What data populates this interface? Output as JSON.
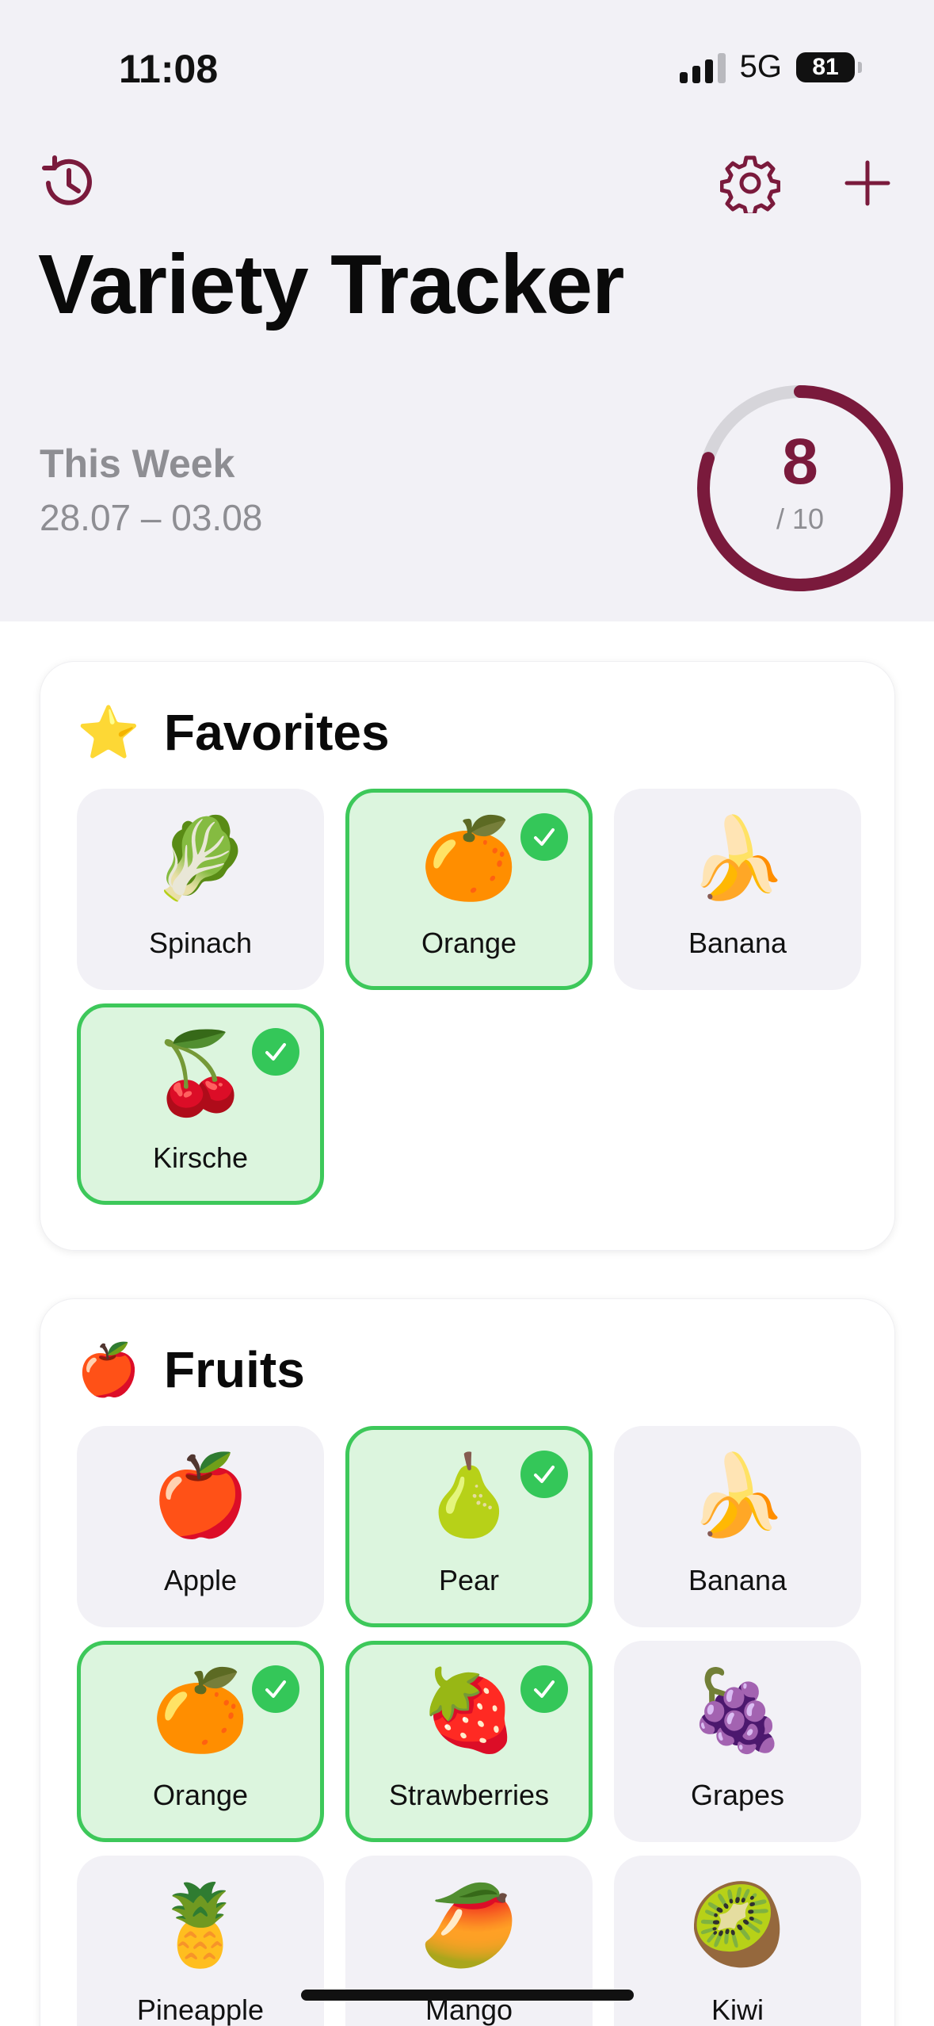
{
  "status_bar": {
    "time": "11:08",
    "network": "5G",
    "battery": "81"
  },
  "header": {
    "title": "Variety Tracker",
    "week_label": "This Week",
    "week_range": "28.07 – 03.08",
    "progress": {
      "count": "8",
      "total": "/ 10",
      "fraction": 0.8
    },
    "icons": {
      "history": "history-icon",
      "settings": "gear-icon",
      "add": "plus-icon"
    }
  },
  "colors": {
    "accent": "#7a1a3c",
    "check": "#34c759",
    "checked_bg": "#dcf5de",
    "tile_bg": "#f2f1f6"
  },
  "favorites": {
    "emoji": "⭐",
    "title": "Favorites",
    "items": [
      {
        "label": "Spinach",
        "emoji": "🥬",
        "checked": false
      },
      {
        "label": "Orange",
        "emoji": "🍊",
        "checked": true
      },
      {
        "label": "Banana",
        "emoji": "🍌",
        "checked": false
      },
      {
        "label": "Kirsche",
        "emoji": "🍒",
        "checked": true
      }
    ]
  },
  "fruits": {
    "emoji": "🍎",
    "title": "Fruits",
    "items": [
      {
        "label": "Apple",
        "emoji": "🍎",
        "checked": false
      },
      {
        "label": "Pear",
        "emoji": "🍐",
        "checked": true
      },
      {
        "label": "Banana",
        "emoji": "🍌",
        "checked": false
      },
      {
        "label": "Orange",
        "emoji": "🍊",
        "checked": true
      },
      {
        "label": "Strawberries",
        "emoji": "🍓",
        "checked": true
      },
      {
        "label": "Grapes",
        "emoji": "🍇",
        "checked": false
      },
      {
        "label": "Pineapple",
        "emoji": "🍍",
        "checked": false
      },
      {
        "label": "Mango",
        "emoji": "🥭",
        "checked": false
      },
      {
        "label": "Kiwi",
        "emoji": "🥝",
        "checked": false
      }
    ]
  }
}
